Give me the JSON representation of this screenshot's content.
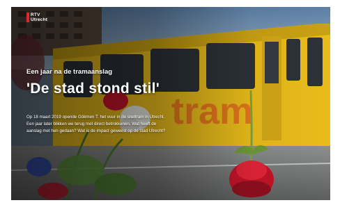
{
  "brand": {
    "line1": "RTV",
    "line2": "Utrecht",
    "accent_color": "#e3262b"
  },
  "hero": {
    "subtitle": "Een jaar na de tramaanslag",
    "title": "'De stad stond stil'",
    "body": "Op 18 maart 2019 opende Gökmen T. het vuur in de sneltram in Utrecht. Een jaar later blikken we terug met direct betrokkenen. Wat heeft de aanslag met hen gedaan? Wat is de impact geweest op de stad Utrecht?",
    "tram_lettering": "tram"
  },
  "colors": {
    "tram_yellow": "#f2c41c",
    "text": "#ffffff"
  },
  "icons": [
    "rtv-utrecht-logo"
  ]
}
